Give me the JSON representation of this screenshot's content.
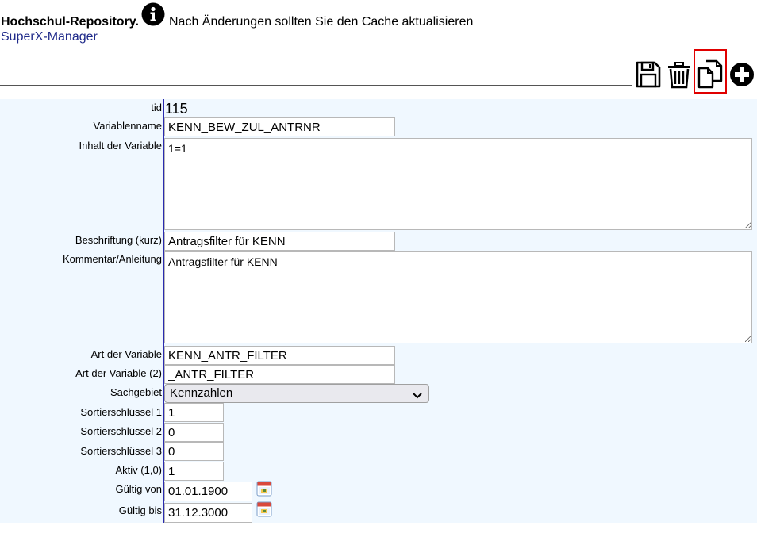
{
  "header": {
    "title": "Hochschul-Repository.",
    "message": "Nach Änderungen sollten Sie den Cache aktualisieren",
    "link": "SuperX-Manager"
  },
  "toolbar": {
    "save_icon": "save-icon",
    "delete_icon": "trash-icon",
    "copy_icon": "copy-icon",
    "add_icon": "plus-circle-icon",
    "highlight_color": "#e00000"
  },
  "form": {
    "tid": {
      "label": "tid",
      "value": "115"
    },
    "variablenname": {
      "label": "Variablenname",
      "value": "KENN_BEW_ZUL_ANTRNR"
    },
    "inhalt": {
      "label": "Inhalt der Variable",
      "value": "1=1"
    },
    "beschriftung": {
      "label": "Beschriftung (kurz)",
      "value": "Antragsfilter für KENN"
    },
    "kommentar": {
      "label": "Kommentar/Anleitung",
      "value": "Antragsfilter für KENN"
    },
    "art": {
      "label": "Art der Variable",
      "value": "KENN_ANTR_FILTER"
    },
    "art2": {
      "label": "Art der Variable (2)",
      "value": "_ANTR_FILTER"
    },
    "sachgebiet": {
      "label": "Sachgebiet",
      "value": "Kennzahlen"
    },
    "sort1": {
      "label": "Sortierschlüssel 1",
      "value": "1"
    },
    "sort2": {
      "label": "Sortierschlüssel 2",
      "value": "0"
    },
    "sort3": {
      "label": "Sortierschlüssel 3",
      "value": "0"
    },
    "aktiv": {
      "label": "Aktiv (1,0)",
      "value": "1"
    },
    "gueltig_von": {
      "label": "Gültig von",
      "value": "01.01.1900"
    },
    "gueltig_bis": {
      "label": "Gültig bis",
      "value": "31.12.3000"
    }
  },
  "colors": {
    "panel_bg": "#f0f8ff",
    "link": "#1f2a8a",
    "divider": "#2a2ab0"
  }
}
